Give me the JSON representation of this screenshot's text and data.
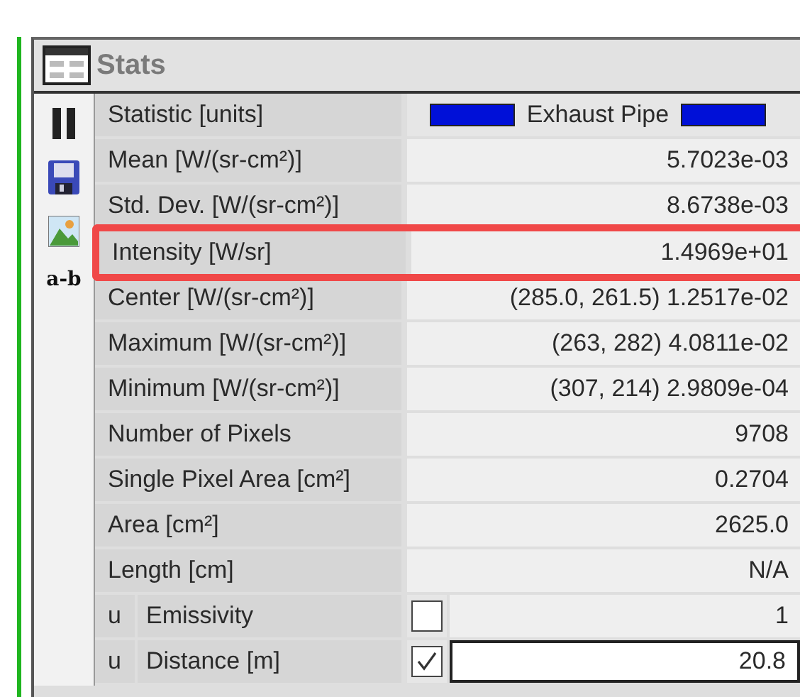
{
  "panel": {
    "title": "Stats"
  },
  "toolbar": [
    {
      "kind": "pause"
    },
    {
      "kind": "save"
    },
    {
      "kind": "image"
    },
    {
      "kind": "text",
      "label": "a-b"
    }
  ],
  "table": {
    "header": {
      "label": "Statistic [units]",
      "value": "Exhaust Pipe",
      "color": "#0010d8"
    },
    "rows": [
      {
        "kind": "stat",
        "label": "Mean [W/(sr-cm²)]",
        "value": "5.7023e-03",
        "highlighted": false
      },
      {
        "kind": "stat",
        "label": "Std. Dev. [W/(sr-cm²)]",
        "value": "8.6738e-03",
        "highlighted": false
      },
      {
        "kind": "stat",
        "label": "Intensity [W/sr]",
        "value": "1.4969e+01",
        "highlighted": true
      },
      {
        "kind": "stat",
        "label": "Center [W/(sr-cm²)]",
        "value": "(285.0, 261.5) 1.2517e-02",
        "highlighted": false
      },
      {
        "kind": "stat",
        "label": "Maximum [W/(sr-cm²)]",
        "value": "(263, 282) 4.0811e-02",
        "highlighted": false
      },
      {
        "kind": "stat",
        "label": "Minimum [W/(sr-cm²)]",
        "value": "(307, 214) 2.9809e-04",
        "highlighted": false
      },
      {
        "kind": "stat",
        "label": "Number of Pixels",
        "value": "9708",
        "highlighted": false
      },
      {
        "kind": "stat",
        "label": "Single Pixel Area [cm²]",
        "value": "0.2704",
        "highlighted": false
      },
      {
        "kind": "stat",
        "label": "Area [cm²]",
        "value": "2625.0",
        "highlighted": false
      },
      {
        "kind": "stat",
        "label": "Length [cm]",
        "value": "N/A",
        "highlighted": false
      },
      {
        "kind": "input",
        "unit": "u",
        "label": "Emissivity",
        "checked": false,
        "value": "1",
        "editing": false
      },
      {
        "kind": "input",
        "unit": "u",
        "label": "Distance [m]",
        "checked": true,
        "value": "20.8",
        "editing": true
      }
    ]
  }
}
